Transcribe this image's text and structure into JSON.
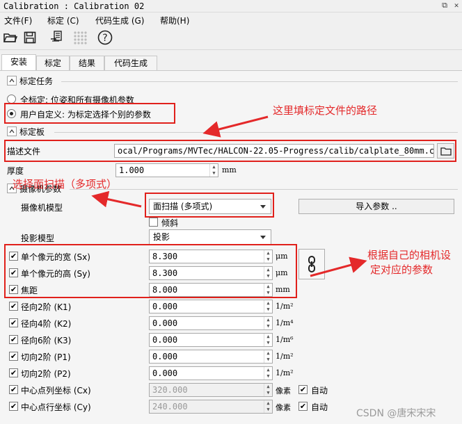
{
  "window": {
    "title": "Calibration : Calibration 02"
  },
  "menu": [
    "文件(F)",
    "标定 (C)",
    "代码生成 (G)",
    "帮助(H)"
  ],
  "toolbar": {
    "icons": [
      "open-icon",
      "save-icon",
      "script-icon",
      "dots-icon",
      "help-icon"
    ],
    "help_glyph": "?"
  },
  "tabs": [
    "安装",
    "标定",
    "结果",
    "代码生成"
  ],
  "calib_task": {
    "header": "标定任务",
    "options": [
      "全标定: 位姿和所有摄像机参数",
      "用户自定义: 为标定选择个别的参数"
    ],
    "selected_index": 1
  },
  "calib_plate": {
    "header": "标定板",
    "desc_label": "描述文件",
    "desc_value": "ocal/Programs/MVTec/HALCON-22.05-Progress/calib/calplate_80mm.cpd",
    "thickness_label": "厚度",
    "thickness_value": "1.000",
    "thickness_unit": "mm"
  },
  "camera": {
    "header": "摄像机参数",
    "model_label": "摄像机模型",
    "model_value": "面扫描 (多项式)",
    "import_button": "导入参数 ..",
    "tilt_label": "倾斜",
    "tilt_checked": false,
    "projection_label": "投影模型",
    "projection_value": "投影",
    "link_icon": "link-icon"
  },
  "params": [
    {
      "label": "单个像元的宽 (Sx)",
      "value": "8.300",
      "unit": "μm",
      "checked": true,
      "disabled": false
    },
    {
      "label": "单个像元的高 (Sy)",
      "value": "8.300",
      "unit": "μm",
      "checked": true,
      "disabled": false
    },
    {
      "label": "焦距",
      "value": "8.000",
      "unit": "mm",
      "checked": true,
      "disabled": false
    },
    {
      "label": "径向2阶 (K1)",
      "value": "0.000",
      "unit": "1/m²",
      "checked": true,
      "disabled": false
    },
    {
      "label": "径向4阶 (K2)",
      "value": "0.000",
      "unit": "1/m⁴",
      "checked": true,
      "disabled": false
    },
    {
      "label": "径向6阶 (K3)",
      "value": "0.000",
      "unit": "1/m⁶",
      "checked": true,
      "disabled": false
    },
    {
      "label": "切向2阶 (P1)",
      "value": "0.000",
      "unit": "1/m²",
      "checked": true,
      "disabled": false
    },
    {
      "label": "切向2阶 (P2)",
      "value": "0.000",
      "unit": "1/m²",
      "checked": true,
      "disabled": false
    },
    {
      "label": "中心点列坐标 (Cx)",
      "value": "320.000",
      "unit": "像素",
      "checked": true,
      "disabled": true,
      "auto_label": "自动",
      "auto_checked": true
    },
    {
      "label": "中心点行坐标 (Cy)",
      "value": "240.000",
      "unit": "像素",
      "checked": true,
      "disabled": true,
      "auto_label": "自动",
      "auto_checked": true
    }
  ],
  "annotations": {
    "a1": "这里填标定文件的路径",
    "a2": "选择面扫描（多项式）",
    "a3_line1": "根据自己的相机设",
    "a3_line2": "定对应的参数",
    "color": "#e4292a"
  },
  "watermark": "CSDN @唐宋宋宋"
}
